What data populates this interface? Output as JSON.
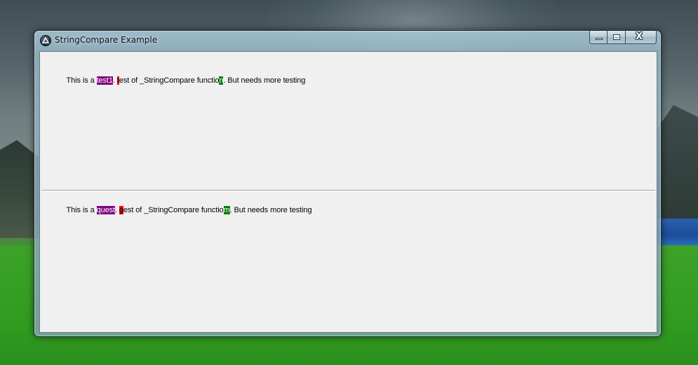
{
  "window": {
    "title": "StringCompare Example",
    "caption_buttons": {
      "minimize": "minimize",
      "maximize": "maximize",
      "close": "X"
    }
  },
  "compare": {
    "line1": {
      "segments": [
        {
          "text": "This is a ",
          "highlight": "none"
        },
        {
          "text": "test1",
          "highlight": "purple"
        },
        {
          "text": ". ",
          "highlight": "none"
        },
        {
          "text": "t",
          "highlight": "red"
        },
        {
          "text": "est of _StringCompare functio",
          "highlight": "none"
        },
        {
          "text": "n",
          "highlight": "green"
        },
        {
          "text": ". But needs more testing",
          "highlight": "none"
        }
      ]
    },
    "line2": {
      "segments": [
        {
          "text": "This is a ",
          "highlight": "none"
        },
        {
          "text": "quest",
          "highlight": "purple"
        },
        {
          "text": ". ",
          "highlight": "none"
        },
        {
          "text": "g",
          "highlight": "red"
        },
        {
          "text": "est of _StringCompare functio",
          "highlight": "none"
        },
        {
          "text": "m",
          "highlight": "green"
        },
        {
          "text": ". But needs more testing",
          "highlight": "none"
        }
      ]
    }
  },
  "colors": {
    "purple": "#800080",
    "red": "#ff0000",
    "green": "#008000",
    "client_bg": "#f0f0f0"
  },
  "icons": {
    "app": "autoit-logo-icon",
    "minimize": "minimize-icon",
    "maximize": "maximize-icon",
    "close": "close-icon"
  }
}
